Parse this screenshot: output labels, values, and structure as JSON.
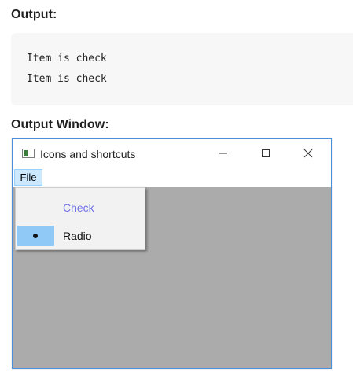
{
  "headings": {
    "output": "Output:",
    "output_window": "Output Window:"
  },
  "output_lines": [
    "Item is check",
    "Item is check"
  ],
  "window": {
    "title": "Icons and shortcuts",
    "icon": "app-window-icon",
    "controls": [
      "minimize",
      "maximize",
      "close"
    ],
    "menubar": {
      "file_label": "File"
    },
    "dropdown": {
      "items": [
        {
          "label": "Check",
          "type": "check",
          "checked": false
        },
        {
          "label": "Radio",
          "type": "radio",
          "selected": true
        }
      ]
    }
  },
  "colors": {
    "window_border": "#4a90d9",
    "client_area": "#ababab",
    "menu_highlight": "#cce8ff",
    "radio_highlight": "#90c8f6",
    "check_text": "#6f70e6"
  }
}
